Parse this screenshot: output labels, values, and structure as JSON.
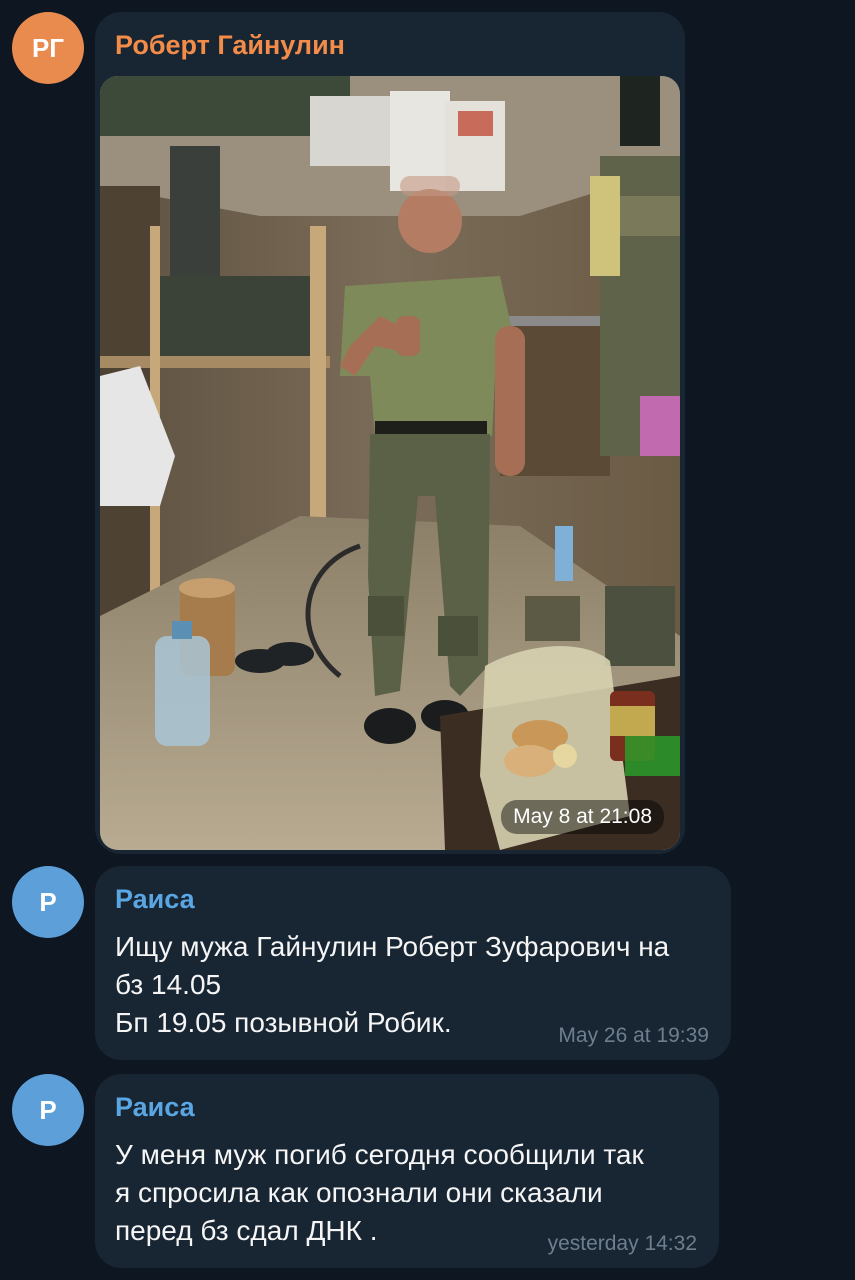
{
  "messages": [
    {
      "sender": "Роберт Гайнулин",
      "initials": "РГ",
      "avatar_color": "#e98b4e",
      "name_color": "#f28c48",
      "time": "May 8 at 21:08"
    },
    {
      "sender": "Раиса",
      "initials": "Р",
      "avatar_color": "#5d9fd8",
      "name_color": "#5aa6e3",
      "text": "Ищу мужа Гайнулин Роберт Зуфарович на\nбз 14.05\nБп 19.05 позывной Робик.",
      "time": "May 26 at 19:39"
    },
    {
      "sender": "Раиса",
      "initials": "Р",
      "avatar_color": "#5d9fd8",
      "name_color": "#5aa6e3",
      "text": "У меня муж погиб сегодня сообщили так\nя спросила как опознали  они сказали\nперед бз сдал ДНК .",
      "time": "yesterday 14:32"
    }
  ]
}
